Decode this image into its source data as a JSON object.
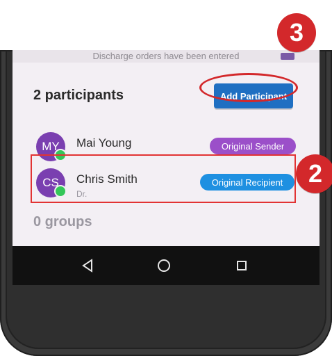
{
  "app": {
    "top_banner_text": "Discharge orders have been entered",
    "participants_title": "2 participants",
    "add_participant_label": "Add Participant",
    "participants": [
      {
        "initials": "MY",
        "name": "Mai Young",
        "subtitle": "",
        "role_label": "Original Sender",
        "role_color": "#9b4fc9",
        "presence_color": "#34c759"
      },
      {
        "initials": "CS",
        "name": "Chris Smith",
        "subtitle": "Dr.",
        "role_label": "Original Recipient",
        "role_color": "#1e90e1",
        "presence_color": "#34c759"
      }
    ],
    "groups_title": "0 groups"
  },
  "annotations": {
    "badge_3": "3",
    "badge_2": "2",
    "accent_red": "#d3282b"
  },
  "navbar": {
    "back_icon": "back-triangle-icon",
    "home_icon": "home-circle-icon",
    "recent_icon": "recent-square-icon"
  }
}
